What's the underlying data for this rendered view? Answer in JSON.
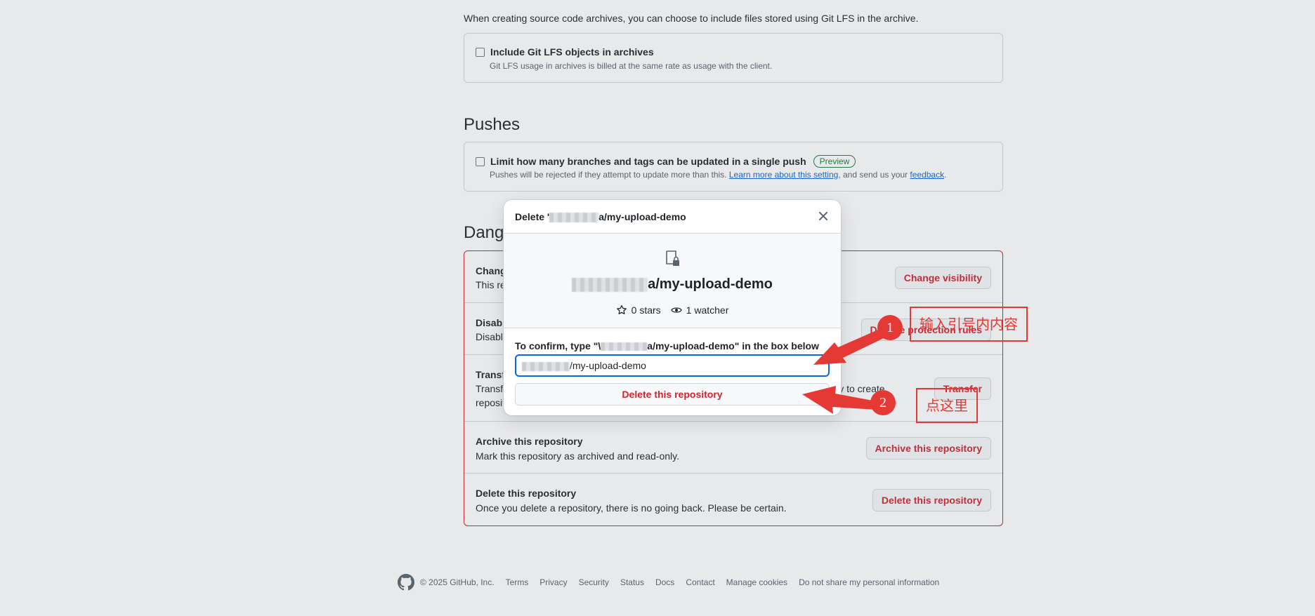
{
  "lfs": {
    "intro": "When creating source code archives, you can choose to include files stored using Git LFS in the archive.",
    "checkbox_label": "Include Git LFS objects in archives",
    "checkbox_note": "Git LFS usage in archives is billed at the same rate as usage with the client."
  },
  "pushes": {
    "heading": "Pushes",
    "checkbox_label": "Limit how many branches and tags can be updated in a single push",
    "badge": "Preview",
    "note_prefix": "Pushes will be rejected if they attempt to update more than this.",
    "learn_more": "Learn more about this setting",
    "note_middle": ", and send us your",
    "feedback": "feedback",
    "note_suffix": "."
  },
  "danger": {
    "heading": "Dang",
    "rows": [
      {
        "title": "Chang",
        "desc": "This re",
        "button": "Change visibility"
      },
      {
        "title": "Disabl",
        "desc": "Disable",
        "button": "Disable      protection rules"
      },
      {
        "title": "Transfe",
        "desc": "Transfe",
        "desc2": "reposit",
        "desc_tail": "ility to create",
        "button": "Transfer"
      },
      {
        "title": "Archive this repository",
        "desc": "Mark this repository as archived and read-only.",
        "button": "Archive this repository"
      },
      {
        "title": "Delete this repository",
        "desc": "Once you delete a repository, there is no going back. Please be certain.",
        "button": "Delete this repository"
      }
    ]
  },
  "dialog": {
    "title_prefix": "Delete '",
    "title_suffix": "a/my-upload-demo",
    "repo_name_suffix": "a/my-upload-demo",
    "stars": "0 stars",
    "watchers": "1 watcher",
    "confirm_prefix": "To confirm, type \"\\",
    "confirm_middle": "a/my-upload-demo",
    "confirm_suffix": "\" in the box below",
    "input_value_suffix": "/my-upload-demo",
    "delete_button": "Delete this repository",
    "close_icon": "close-icon"
  },
  "annotations": {
    "step1_number": "1",
    "step1_text": "输入引号内内容",
    "step2_number": "2",
    "step2_text": "点这里",
    "color": "#e53935"
  },
  "footer": {
    "copyright": "© 2025 GitHub, Inc.",
    "links": [
      "Terms",
      "Privacy",
      "Security",
      "Status",
      "Docs",
      "Contact",
      "Manage cookies",
      "Do not share my personal information"
    ]
  },
  "colors": {
    "danger": "#d1242f",
    "accent": "#0969da",
    "preview": "#1a7f37"
  }
}
